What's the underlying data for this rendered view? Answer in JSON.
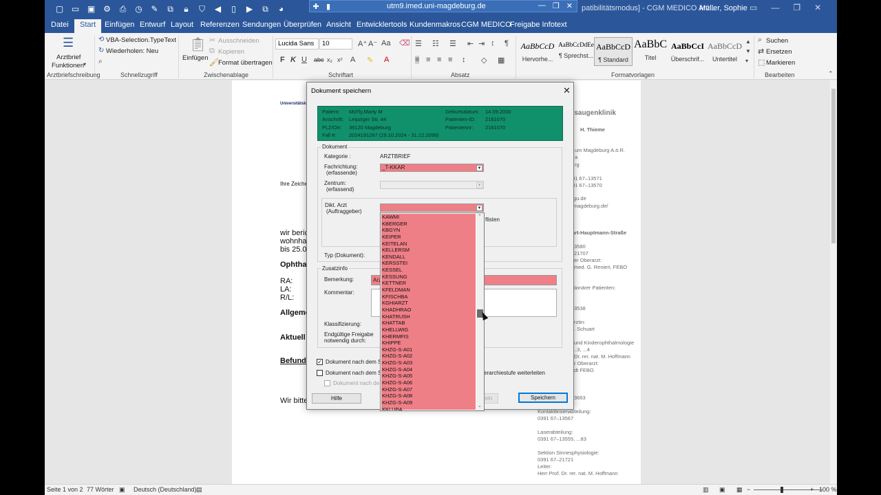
{
  "window": {
    "title": "utm9.imed.uni-magdeburg.de",
    "title_right": "patibilitätsmodus] - CGM MEDICO Arz...",
    "user": "Müller, Sophie"
  },
  "tabs": [
    "Datei",
    "Start",
    "Einfügen",
    "Entwurf",
    "Layout",
    "Referenzen",
    "Sendungen",
    "Überprüfen",
    "Ansicht",
    "Entwicklertools",
    "Kundenmakros",
    "CGM MEDICO",
    "Freigabe Infotext"
  ],
  "ribbon": {
    "arztbrief": "Arztbrief",
    "funktionen": "Funktionen",
    "vba": "VBA-Selection.TypeText",
    "wiederholen": "Wiederholen: Neu",
    "einfuegen": "Einfügen",
    "ausschneiden": "Ausschneiden",
    "kopieren": "Kopieren",
    "format_uebertragen": "Format übertragen",
    "font_name": "Lucida Sans",
    "font_size": "10",
    "styles": [
      {
        "preview": "AaBbCcD",
        "name": "Hervorhe..."
      },
      {
        "preview": "AaBbCcDdEe",
        "name": "¶ Sprechst..."
      },
      {
        "preview": "AaBbCcD",
        "name": "¶ Standard"
      },
      {
        "preview": "AaBbC",
        "name": "Titel"
      },
      {
        "preview": "AaBbCcI",
        "name": "Überschrif..."
      },
      {
        "preview": "AaBbCcD",
        "name": "Untertitel"
      }
    ],
    "suchen": "Suchen",
    "ersetzen": "Ersetzen",
    "markieren": "Markieren",
    "groups": {
      "arztbriefschreibung": "Arztbriefschreibung",
      "schnellzugriff": "Schnellzugriff",
      "zwischenablage": "Zwischenablage",
      "schriftart": "Schriftart",
      "absatz": "Absatz",
      "formatvorlagen": "Formatvorlagen",
      "bearbeiten": "Bearbeiten"
    }
  },
  "document": {
    "header_small": "Universitätsklin",
    "ihre_zeichen": "Ihre Zeiche",
    "line1": "wir beric",
    "line2": "wohnhaf",
    "line3": "bis 25.0",
    "ophthal": "Ophthal",
    "ra": "RA:",
    "la": "LA:",
    "rl": "R/L:",
    "allgem": "Allgeme",
    "aktuell": "Aktuell",
    "befund": "Befund",
    "wir_bitte": "Wir bitte",
    "side": [
      "tsaugenklinik",
      "H. Thieme",
      "um Magdeburg A.ö.R.",
      "a",
      "rg",
      "91 67–13571",
      "91 67–13570",
      "gu.de",
      "magdeburg.de/",
      "art-Hauptmann-Straße",
      "3580",
      "21707",
      "er Oberarzt:",
      "med. G. Renieri, FEBO",
      "tionärer Patienten:",
      "3538",
      "rztin:",
      ". Schuart",
      "und Kinderophthalmologie",
      "..3, ...4",
      "Dr. rer. nat. M. Hoffmann",
      "r Oberarzt:",
      "dt FEBO",
      "3663",
      "Kontaktlinsenabteilung:",
      "0391 67–13567",
      "Laserabteilung:",
      "0391 67–13555, ...83",
      "Sektion Sinnesphysiologie:",
      "0391 67–21721",
      "Leiter:",
      "Herr Prof. Dr. rer. nat. M. Hoffmann"
    ]
  },
  "dialog": {
    "title": "Dokument speichern",
    "patient": {
      "patient_label": "Patient:",
      "patient_value": "McFly,Marty  M",
      "anschrift_label": "Anschrift:",
      "anschrift_value": "Leipziger Str. 44",
      "plz_label": "PLZ/Ort:",
      "plz_value": "39120 Magdeburg",
      "fall_label": "Fall #:",
      "fall_value": "2024191267 (29.10.2024 - 31.12.2099)",
      "geb_label": "Geburtsdatum:",
      "geb_value": "14.09.2000",
      "pid_label": "Patienten-ID:",
      "pid_value": "2161070",
      "pnr_label": "Patientennr:",
      "pnr_value": "2161070"
    },
    "dokument_legend": "Dokument",
    "kategorie_label": "Kategorie :",
    "kategorie_value": "ARZTBRIEF",
    "fachrichtung_label": "Fachrichtung:",
    "fachrichtung_sub": "(erfassende)",
    "fachrichtung_value": "_T-KKAR",
    "zentrum_label": "Zentrum:",
    "zentrum_sub": "(erfassend)",
    "dikt_label": "Dikt. Arzt",
    "dikt_sub": "(Auftraggeber)",
    "listen_text": "flisten",
    "typ_label": "Typ (Dokument):",
    "zusatz_legend": "Zusatzinfo",
    "bemerkung_label": "Bemerkung:",
    "bemerkung_value": "Arz",
    "kommentar_label": "Kommentar:",
    "klassifizierung_label": "Klassifizierung:",
    "freigabe_label": "Endgültige Freigabe",
    "freigabe_sub": "notwendig durch:",
    "chk1": "Dokument nach dem S",
    "chk2": "Dokument nach dem S",
    "chk2_right": "erarchiestufe weiterleiten",
    "chk3": "Dokument nach de",
    "hilfe": "Hilfe",
    "mid_btn": "eln",
    "speichern": "Speichern",
    "dropdown_items": [
      "KAWMI",
      "KBERGER",
      "KBGYN",
      "KEIPER",
      "KEITELAN",
      "KELLERSM",
      "KENDALL",
      "KERSSTEI",
      "KESSEL",
      "KESSUNG",
      "KETTNER",
      "KFELDMAN",
      "KFISCHBA",
      "KGHIARZT",
      "KHADHRAO",
      "KHATRUSH",
      "KHATTAB",
      "KHELLWIG",
      "KHERMFIS",
      "KHIPPE",
      "KHZG-S-A01",
      "KHZG-S-A02",
      "KHZG-S-A03",
      "KHZG-S-A04",
      "KHZG-S-A05",
      "KHZG-S-A06",
      "KHZG-S-A07",
      "KHZG-S-A08",
      "KHZG-S-A09",
      "KKLUBA"
    ]
  },
  "status": {
    "seite": "Seite 1 von 2",
    "woerter": "77 Wörter",
    "sprache": "Deutsch (Deutschland)",
    "zoom": "100 %"
  }
}
